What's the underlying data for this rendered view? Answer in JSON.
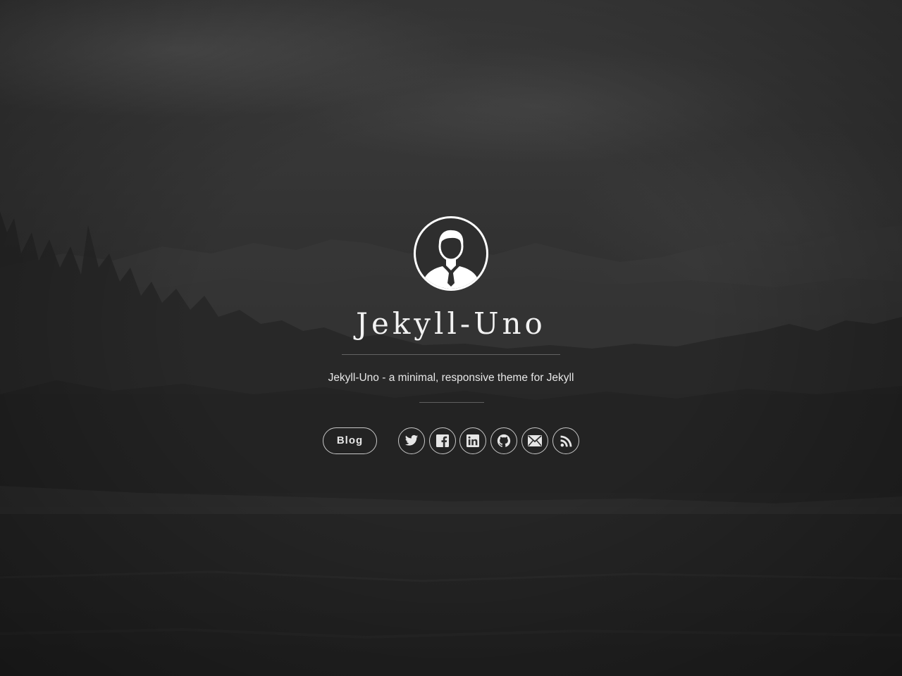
{
  "site": {
    "title": "Jekyll-Uno",
    "description": "Jekyll-Uno - a minimal, responsive theme for Jekyll"
  },
  "avatar": {
    "icon": "user-avatar-icon"
  },
  "navigation": {
    "links": [
      {
        "label": "Blog"
      }
    ]
  },
  "social": [
    {
      "name": "twitter",
      "icon": "twitter-icon"
    },
    {
      "name": "facebook",
      "icon": "facebook-icon"
    },
    {
      "name": "linkedin",
      "icon": "linkedin-icon"
    },
    {
      "name": "github",
      "icon": "github-icon"
    },
    {
      "name": "email",
      "icon": "mail-icon"
    },
    {
      "name": "rss",
      "icon": "rss-icon"
    }
  ],
  "colors": {
    "text": "#f2f2f2",
    "border": "#ffffff",
    "background": "#2f2f2f"
  }
}
